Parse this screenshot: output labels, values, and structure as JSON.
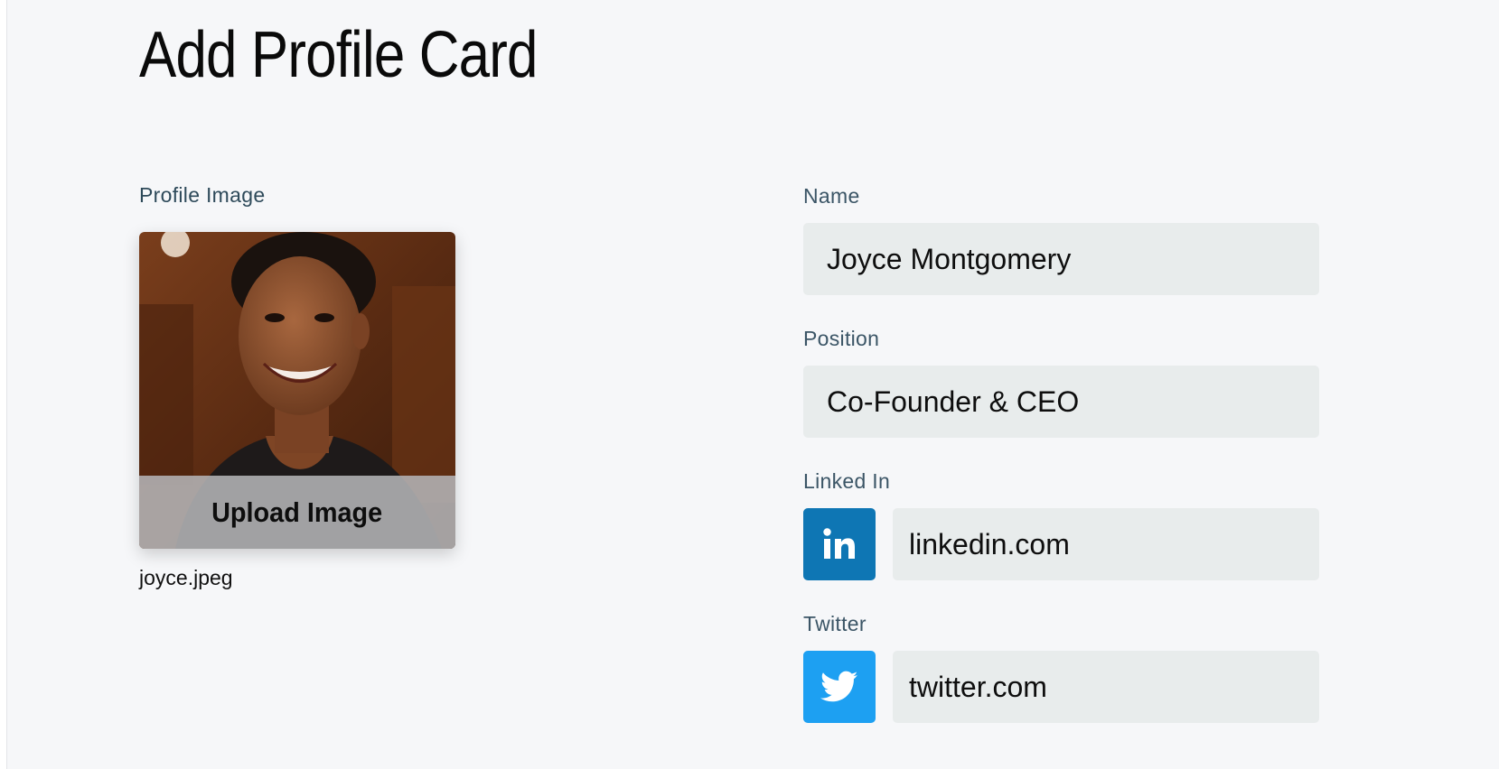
{
  "page": {
    "title": "Add Profile Card"
  },
  "profile_image": {
    "label": "Profile Image",
    "upload_label": "Upload Image",
    "filename": "joyce.jpeg"
  },
  "form": {
    "name": {
      "label": "Name",
      "value": "Joyce Montgomery"
    },
    "position": {
      "label": "Position",
      "value": "Co-Founder & CEO"
    },
    "linkedin": {
      "label": "Linked In",
      "value": "linkedin.com",
      "icon": "linkedin-icon",
      "color": "#0e76b4"
    },
    "twitter": {
      "label": "Twitter",
      "value": "twitter.com",
      "icon": "twitter-icon",
      "color": "#1da0f2"
    }
  },
  "colors": {
    "background": "#f6f7f9",
    "input_background": "#e8ecec",
    "label_text": "#3b5566"
  }
}
